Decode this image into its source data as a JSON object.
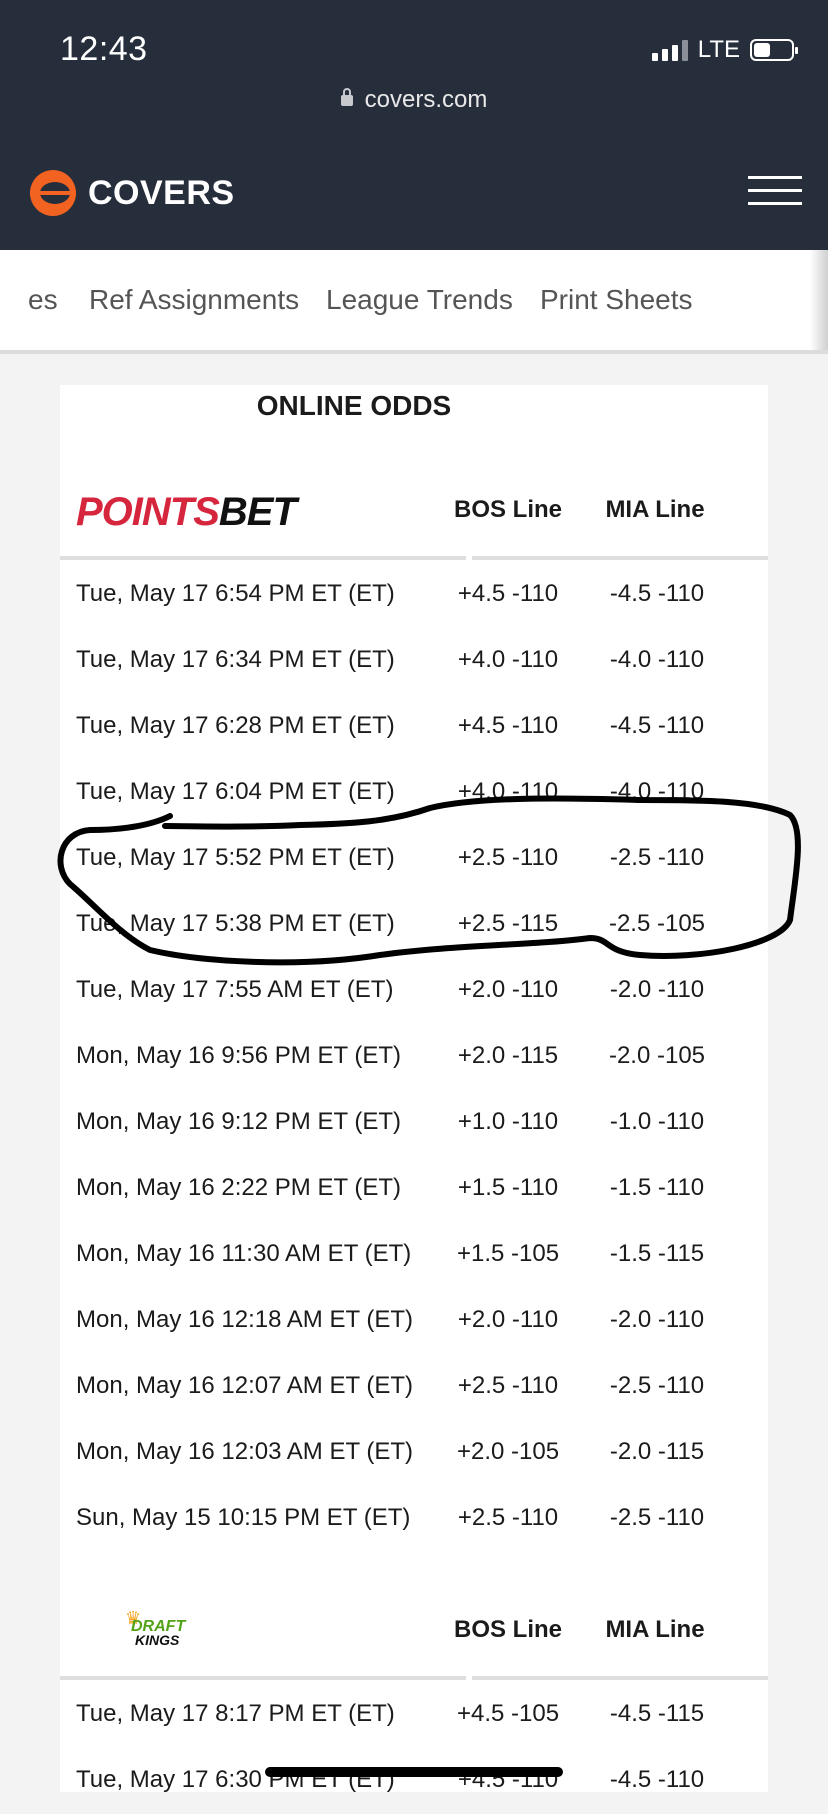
{
  "status": {
    "time": "12:43",
    "network": "LTE",
    "battery_level": 0.45
  },
  "browser": {
    "url": "covers.com"
  },
  "brand": {
    "name": "COVERS",
    "accent": "#f26322"
  },
  "tabs": [
    "es",
    "Ref Assignments",
    "League Trends",
    "Print Sheets"
  ],
  "section_title": "ONLINE ODDS",
  "books": [
    {
      "name": "POINTSBET",
      "name_part1": "POINTS",
      "name_part2": "BET",
      "bos_header": "BOS Line",
      "mia_header": "MIA Line",
      "rows": [
        {
          "date": "Tue, May 17 6:54 PM ET (ET)",
          "bos": "+4.5 -110",
          "mia": "-4.5 -110"
        },
        {
          "date": "Tue, May 17 6:34 PM ET (ET)",
          "bos": "+4.0 -110",
          "mia": "-4.0 -110"
        },
        {
          "date": "Tue, May 17 6:28 PM ET (ET)",
          "bos": "+4.5 -110",
          "mia": "-4.5 -110"
        },
        {
          "date": "Tue, May 17 6:04 PM ET (ET)",
          "bos": "+4.0 -110",
          "mia": "-4.0 -110"
        },
        {
          "date": "Tue, May 17 5:52 PM ET (ET)",
          "bos": "+2.5 -110",
          "mia": "-2.5 -110"
        },
        {
          "date": "Tue, May 17 5:38 PM ET (ET)",
          "bos": "+2.5 -115",
          "mia": "-2.5 -105"
        },
        {
          "date": "Tue, May 17 7:55 AM ET (ET)",
          "bos": "+2.0 -110",
          "mia": "-2.0 -110"
        },
        {
          "date": "Mon, May 16 9:56 PM ET (ET)",
          "bos": "+2.0 -115",
          "mia": "-2.0 -105"
        },
        {
          "date": "Mon, May 16 9:12 PM ET (ET)",
          "bos": "+1.0 -110",
          "mia": "-1.0 -110"
        },
        {
          "date": "Mon, May 16 2:22 PM ET (ET)",
          "bos": "+1.5 -110",
          "mia": "-1.5 -110"
        },
        {
          "date": "Mon, May 16 11:30 AM ET (ET)",
          "bos": "+1.5 -105",
          "mia": "-1.5 -115"
        },
        {
          "date": "Mon, May 16 12:18 AM ET (ET)",
          "bos": "+2.0 -110",
          "mia": "-2.0 -110"
        },
        {
          "date": "Mon, May 16 12:07 AM ET (ET)",
          "bos": "+2.5 -110",
          "mia": "-2.5 -110"
        },
        {
          "date": "Mon, May 16 12:03 AM ET (ET)",
          "bos": "+2.0 -105",
          "mia": "-2.0 -115"
        },
        {
          "date": "Sun, May 15 10:15 PM ET (ET)",
          "bos": "+2.5 -110",
          "mia": "-2.5 -110"
        }
      ]
    },
    {
      "name": "DRAFT KINGS",
      "name_part1": "DRAFT",
      "name_part2": "KINGS",
      "bos_header": "BOS Line",
      "mia_header": "MIA Line",
      "rows": [
        {
          "date": "Tue, May 17 8:17 PM ET (ET)",
          "bos": "+4.5 -105",
          "mia": "-4.5 -115"
        },
        {
          "date": "Tue, May 17 6:30 PM ET (ET)",
          "bos": "+4.5 -110",
          "mia": "-4.5 -110"
        }
      ]
    }
  ]
}
